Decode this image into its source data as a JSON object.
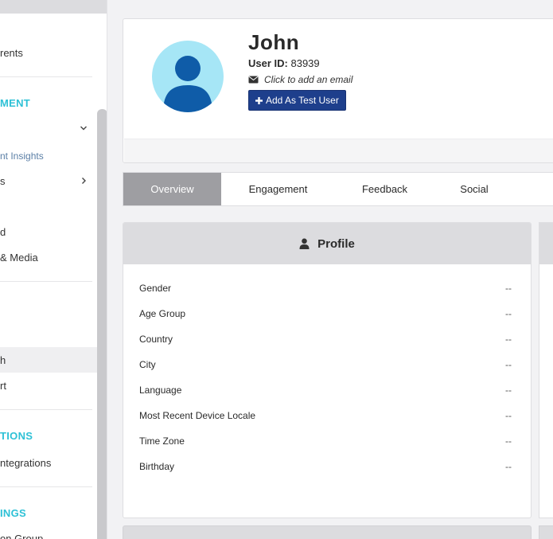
{
  "sidebar": {
    "items": [
      {
        "label": "rents"
      },
      {
        "label": "MENT"
      },
      {
        "label": "nt Insights"
      },
      {
        "label": "s"
      },
      {
        "label": "d"
      },
      {
        "label": "& Media"
      },
      {
        "label": "h"
      },
      {
        "label": "rt"
      },
      {
        "label": "TIONS"
      },
      {
        "label": "ntegrations"
      },
      {
        "label": "INGS"
      },
      {
        "label": "on Group"
      }
    ]
  },
  "user": {
    "name": "John",
    "id_label": "User ID:",
    "id_value": "83939",
    "email_placeholder": "Click to add an email",
    "test_button_label": "Add As Test User"
  },
  "tabs": [
    {
      "label": "Overview",
      "active": true
    },
    {
      "label": "Engagement",
      "active": false
    },
    {
      "label": "Feedback",
      "active": false
    },
    {
      "label": "Social",
      "active": false
    }
  ],
  "profile": {
    "title": "Profile",
    "rows": [
      {
        "label": "Gender",
        "value": "--"
      },
      {
        "label": "Age Group",
        "value": "--"
      },
      {
        "label": "Country",
        "value": "--"
      },
      {
        "label": "City",
        "value": "--"
      },
      {
        "label": "Language",
        "value": "--"
      },
      {
        "label": "Most Recent Device Locale",
        "value": "--"
      },
      {
        "label": "Time Zone",
        "value": "--"
      },
      {
        "label": "Birthday",
        "value": "--"
      }
    ]
  },
  "colors": {
    "accent_teal": "#2ec1d6",
    "button_navy": "#1e3f8c",
    "avatar_bg": "#a6e6f6",
    "avatar_fg": "#0f5ca8",
    "active_tab": "#9e9ea2"
  },
  "icons": {
    "email": "envelope-icon",
    "add": "plus-icon",
    "profile": "user-icon",
    "chevron_down": "chevron-down-icon",
    "chevron_right": "chevron-right-icon"
  }
}
